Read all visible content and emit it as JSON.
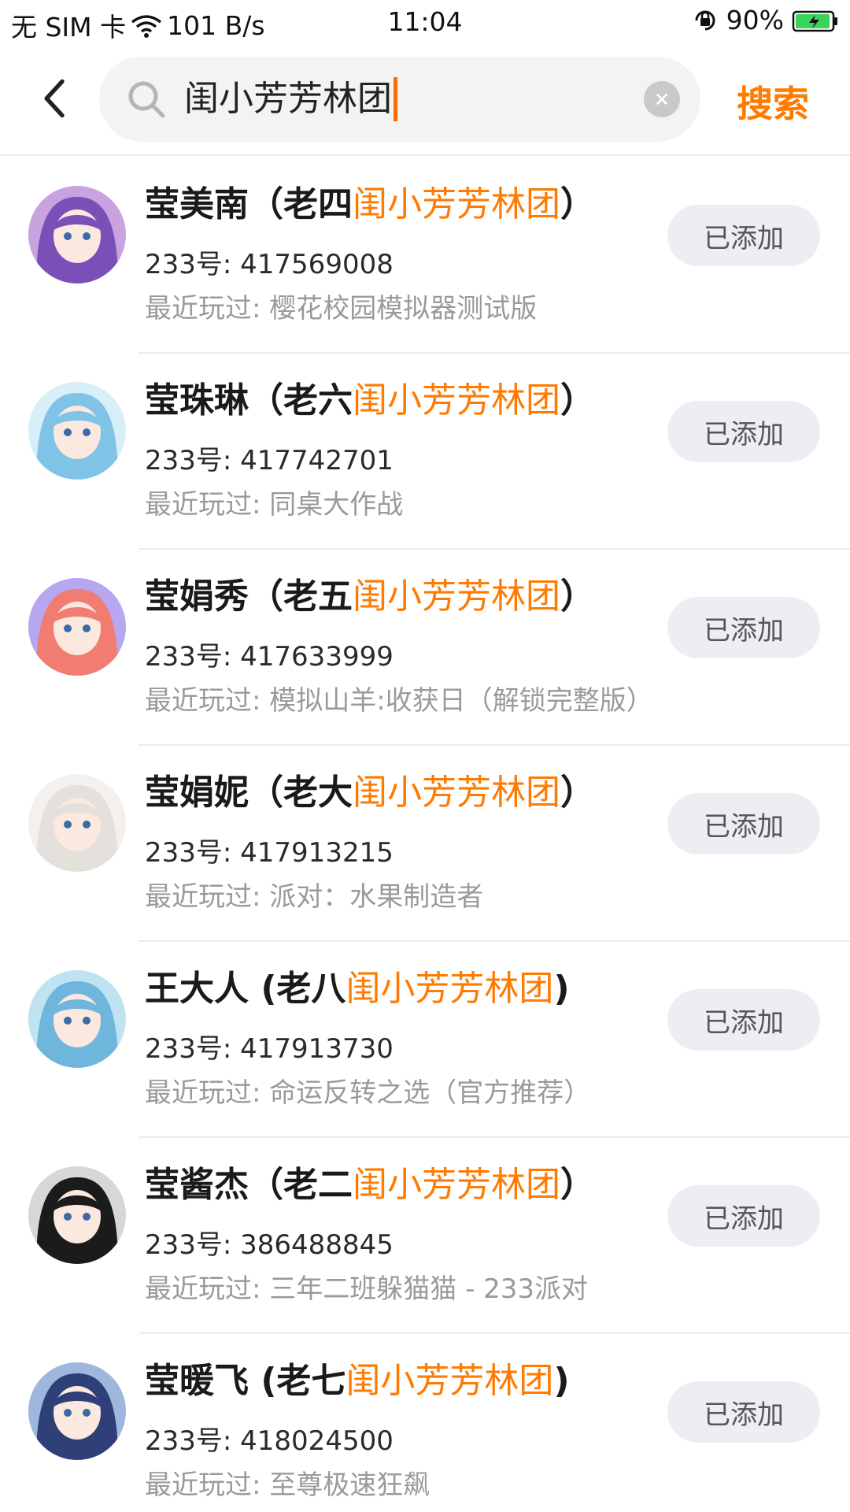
{
  "status_bar": {
    "carrier": "无 SIM 卡",
    "net_speed": "101 B/s",
    "time": "11:04",
    "battery": "90%"
  },
  "search": {
    "query": "闺小芳芳林团",
    "search_label": "搜索"
  },
  "results": [
    {
      "name_prefix": "莹美南（老四",
      "highlight": "闺小芳芳林团",
      "name_suffix": "）",
      "uid": "233号: 417569008",
      "recent": "最近玩过: 樱花校园模拟器测试版",
      "button": "已添加",
      "avatar_color": "#c9a3e0",
      "avatar_hair": "#7a4fb8"
    },
    {
      "name_prefix": "莹珠琳（老六",
      "highlight": "闺小芳芳林团",
      "name_suffix": "）",
      "uid": "233号: 417742701",
      "recent": "最近玩过: 同桌大作战",
      "button": "已添加",
      "avatar_color": "#d8eef8",
      "avatar_hair": "#7fc4e6"
    },
    {
      "name_prefix": "莹娟秀（老五",
      "highlight": "闺小芳芳林团",
      "name_suffix": "）",
      "uid": "233号: 417633999",
      "recent": "最近玩过: 模拟山羊:收获日（解锁完整版）",
      "button": "已添加",
      "avatar_color": "#b7a6f0",
      "avatar_hair": "#f07c72"
    },
    {
      "name_prefix": "莹娟妮（老大",
      "highlight": "闺小芳芳林团",
      "name_suffix": "）",
      "uid": "233号: 417913215",
      "recent": "最近玩过: 派对：水果制造者",
      "button": "已添加",
      "avatar_color": "#f4f0ee",
      "avatar_hair": "#e4e0dc"
    },
    {
      "name_prefix": "王大人 (老八",
      "highlight": "闺小芳芳林团",
      "name_suffix": ")",
      "uid": "233号: 417913730",
      "recent": "最近玩过: 命运反转之选（官方推荐）",
      "button": "已添加",
      "avatar_color": "#bfe3f2",
      "avatar_hair": "#6fb6dc"
    },
    {
      "name_prefix": "莹酱杰（老二",
      "highlight": "闺小芳芳林团",
      "name_suffix": "）",
      "uid": "233号: 386488845",
      "recent": "最近玩过: 三年二班躲猫猫 - 233派对",
      "button": "已添加",
      "avatar_color": "#d7d7d7",
      "avatar_hair": "#1b1b1b"
    },
    {
      "name_prefix": "莹暖飞 (老七",
      "highlight": "闺小芳芳林团",
      "name_suffix": ")",
      "uid": "233号: 418024500",
      "recent": "最近玩过: 至尊极速狂飙",
      "button": "已添加",
      "avatar_color": "#9fb7dd",
      "avatar_hair": "#2f3f78"
    }
  ],
  "colors": {
    "accent": "#ff7a00",
    "button_bg": "#eceef3"
  }
}
